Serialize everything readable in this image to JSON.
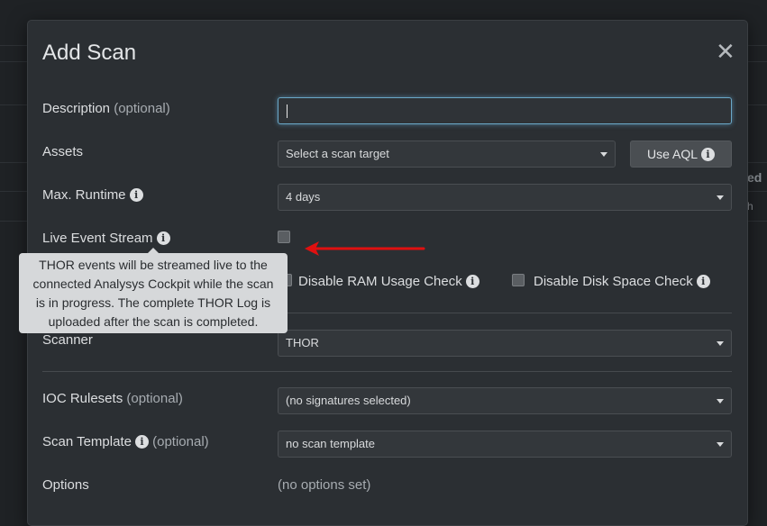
{
  "background": {
    "right_text_1": "ed",
    "right_text_2": "h"
  },
  "modal": {
    "title": "Add Scan",
    "close_label": "✕"
  },
  "form": {
    "description": {
      "label": "Description",
      "optional": "(optional)"
    },
    "assets": {
      "label": "Assets",
      "placeholder": "Select a scan target",
      "aql_button": "Use AQL"
    },
    "max_runtime": {
      "label": "Max. Runtime",
      "value": "4 days"
    },
    "live_event_stream": {
      "label": "Live Event Stream",
      "checked": false
    },
    "disable_ram": {
      "label": "Disable RAM Usage Check",
      "checked": false
    },
    "disable_disk": {
      "label": "Disable Disk Space Check",
      "checked": false
    },
    "scanner": {
      "label": "Scanner",
      "value": "THOR"
    },
    "ioc_rulesets": {
      "label": "IOC Rulesets",
      "optional": "(optional)",
      "value": "(no signatures selected)"
    },
    "scan_template": {
      "label": "Scan Template",
      "optional": "(optional)",
      "value": "no scan template"
    },
    "options": {
      "label": "Options",
      "value": "(no options set)"
    }
  },
  "tooltip": {
    "lines": [
      "THOR events will be streamed live to the",
      "connected Analysys Cockpit while the scan",
      "is in progress. The complete THOR Log is",
      "uploaded after the scan is completed."
    ]
  },
  "icons": {
    "info": "info-icon",
    "close": "close-icon",
    "caret": "caret-down-icon",
    "arrow": "red-arrow-left"
  },
  "colors": {
    "arrow": "#e01010",
    "focus_border": "#6aa8c8",
    "modal_bg": "#2b2f33",
    "page_bg": "#1f2225"
  }
}
